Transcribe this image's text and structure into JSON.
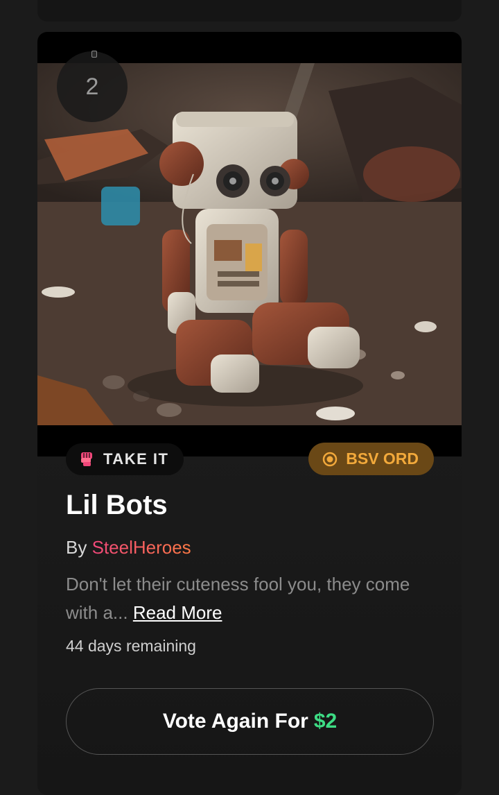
{
  "rank": {
    "number": "2"
  },
  "badges": {
    "take": {
      "label": "TAKE IT",
      "icon": "fist-icon",
      "color": "#f0477a"
    },
    "chain": {
      "label": "BSV ORD",
      "icon": "target-circle-icon",
      "color": "#f2a93b",
      "background": "#6a4816"
    }
  },
  "card": {
    "title": "Lil Bots",
    "by_prefix": "By",
    "creator": "SteelHeroes",
    "description": "Don't let their cuteness fool you, they come with a...",
    "read_more": "Read More",
    "remaining": "44 days remaining"
  },
  "vote": {
    "label": "Vote Again For",
    "price": "$2",
    "price_color": "#3ddc84"
  },
  "image": {
    "subject": "small rusty robot sitting on rubble"
  }
}
